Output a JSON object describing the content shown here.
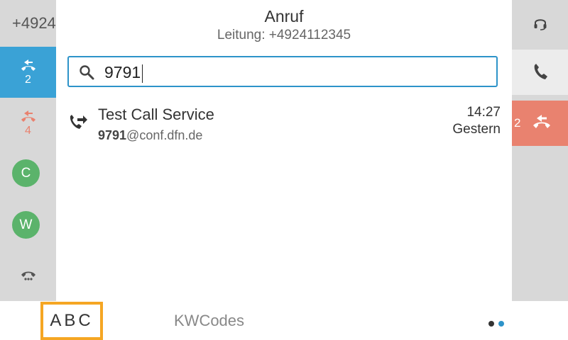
{
  "left_sidebar": {
    "line_number": "+4924",
    "active_slot_count": "2",
    "missed_slot_count": "4",
    "contacts": [
      {
        "initial": "C"
      },
      {
        "initial": "W"
      }
    ]
  },
  "header": {
    "title": "Anruf",
    "subtitle": "Leitung: +4924112345"
  },
  "search": {
    "value": "9791"
  },
  "results": [
    {
      "name": "Test Call Service",
      "address_match": "9791",
      "address_rest": "@conf.dfn.de",
      "time": "14:27",
      "day": "Gestern"
    }
  ],
  "right_sidebar": {
    "missed_count": "2"
  },
  "bottom_bar": {
    "abc_label": "ABC",
    "kwcodes_label": "KWCodes"
  },
  "colors": {
    "accent_blue": "#3aa2d6",
    "missed_red": "#e9826f",
    "avatar_green": "#5bb36b",
    "focus_orange": "#f5a623"
  }
}
